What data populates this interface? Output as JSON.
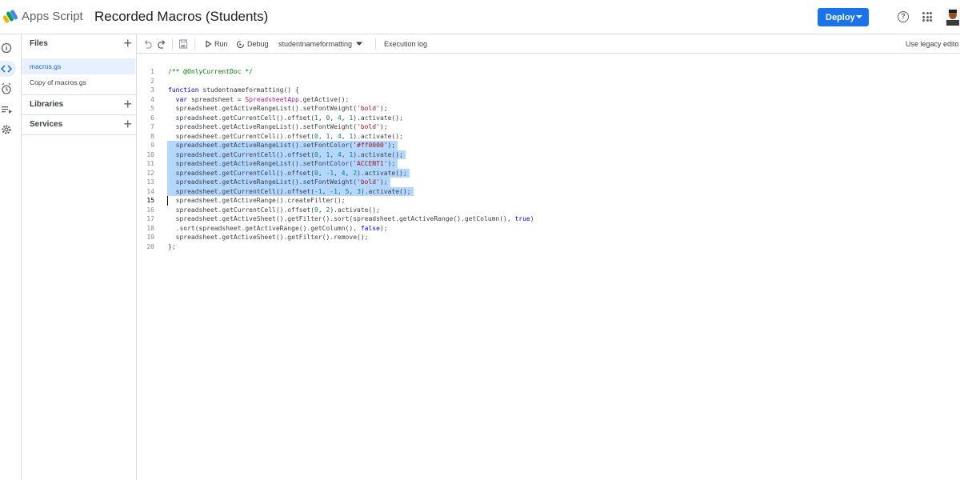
{
  "header": {
    "app_name": "Apps Script",
    "project_title": "Recorded Macros (Students)",
    "deploy_label": "Deploy"
  },
  "sidebar": {
    "files_label": "Files",
    "files": [
      "macros.gs",
      "Copy of macros.gs"
    ],
    "libraries_label": "Libraries",
    "services_label": "Services"
  },
  "toolbar": {
    "run_label": "Run",
    "debug_label": "Debug",
    "function_name": "studentnameformatting",
    "execution_log_label": "Execution log",
    "legacy_label": "Use legacy edito"
  },
  "editor": {
    "lines": [
      "/** @OnlyCurrentDoc */",
      "",
      "function studentnameformatting() {",
      "  var spreadsheet = SpreadsheetApp.getActive();",
      "  spreadsheet.getActiveRangeList().setFontWeight('bold');",
      "  spreadsheet.getCurrentCell().offset(1, 0, 4, 1).activate();",
      "  spreadsheet.getActiveRangeList().setFontWeight('bold');",
      "  spreadsheet.getCurrentCell().offset(0, 1, 4, 1).activate();",
      "  spreadsheet.getActiveRangeList().setFontColor('#ff0000');",
      "  spreadsheet.getCurrentCell().offset(0, 1, 4, 1).activate();",
      "  spreadsheet.getActiveRangeList().setFontColor('ACCENT1');",
      "  spreadsheet.getCurrentCell().offset(0, -1, 4, 2).activate();",
      "  spreadsheet.getActiveRangeList().setFontWeight('bold');",
      "  spreadsheet.getCurrentCell().offset(-1, -1, 5, 3).activate();",
      "  spreadsheet.getActiveRange().createFilter();",
      "  spreadsheet.getCurrentCell().offset(0, 2).activate();",
      "  spreadsheet.getActiveSheet().getFilter().sort(spreadsheet.getActiveRange().getColumn(), true)",
      "  .sort(spreadsheet.getActiveRange().getColumn(), false);",
      "  spreadsheet.getActiveSheet().getFilter().remove();",
      "};"
    ],
    "line_numbers": [
      "1",
      "2",
      "3",
      "4",
      "5",
      "6",
      "7",
      "8",
      "9",
      "10",
      "11",
      "12",
      "13",
      "14",
      "15",
      "16",
      "17",
      "18",
      "19",
      "20"
    ],
    "selected_lines": [
      9,
      10,
      11,
      12,
      13,
      14
    ],
    "cursor_line": 15
  },
  "colors": {
    "accent": "#1a73e8",
    "selection": "#b3d7ff"
  }
}
